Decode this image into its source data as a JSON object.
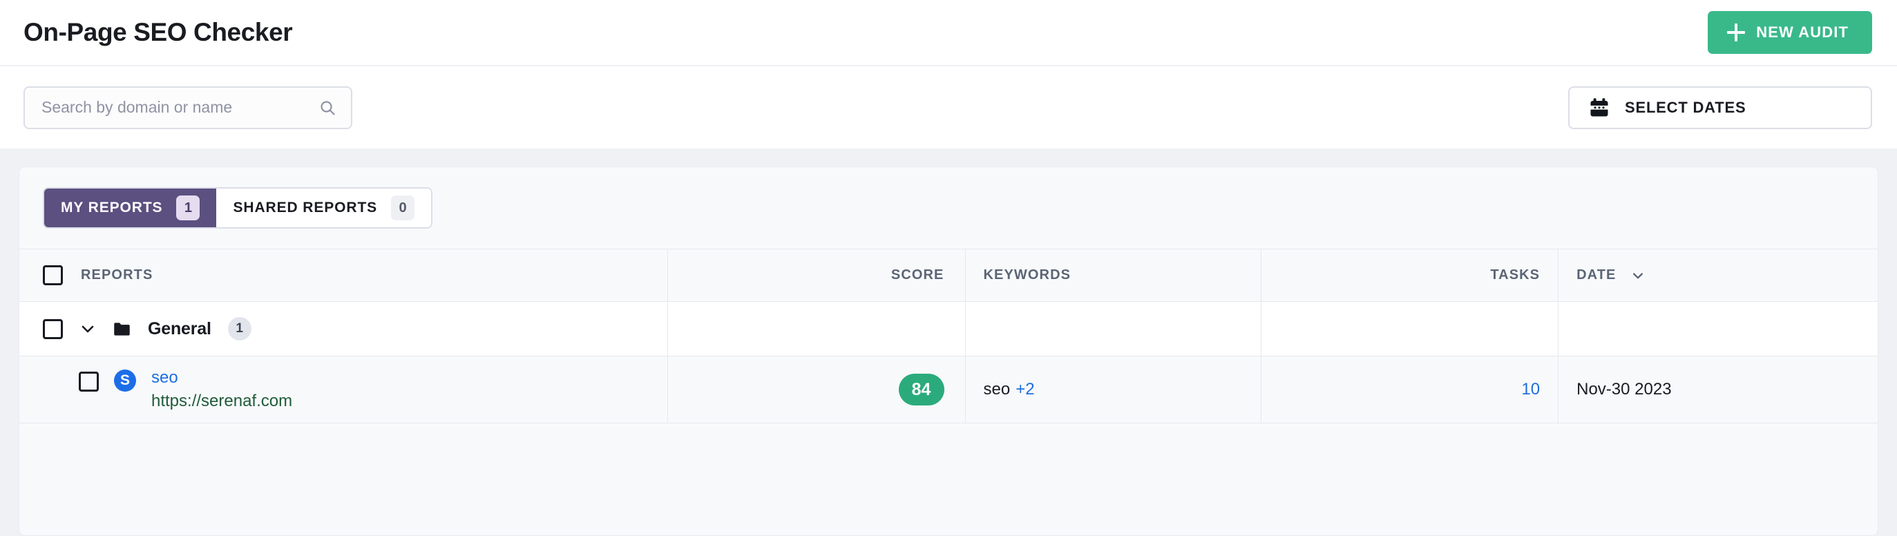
{
  "header": {
    "title": "On-Page SEO Checker",
    "new_audit_label": "NEW AUDIT",
    "plus_icon": "plus-icon"
  },
  "toolbar": {
    "search_placeholder": "Search by domain or name",
    "search_value": "",
    "search_icon": "search-icon",
    "select_dates_label": "SELECT DATES",
    "calendar_icon": "calendar-icon"
  },
  "tabs": [
    {
      "label": "MY REPORTS",
      "count": "1",
      "active": true
    },
    {
      "label": "SHARED REPORTS",
      "count": "0",
      "active": false
    }
  ],
  "table": {
    "columns": [
      {
        "key": "reports",
        "label": "REPORTS"
      },
      {
        "key": "score",
        "label": "SCORE"
      },
      {
        "key": "keywords",
        "label": "KEYWORDS"
      },
      {
        "key": "tasks",
        "label": "TASKS"
      },
      {
        "key": "date",
        "label": "DATE"
      }
    ],
    "sort": {
      "column": "DATE",
      "icon": "chevron-down-icon"
    },
    "folder": {
      "name": "General",
      "count": "1",
      "icon": "folder-icon",
      "expand_icon": "chevron-down-icon"
    },
    "rows": [
      {
        "avatar_letter": "S",
        "name": "seo",
        "url": "https://serenaf.com",
        "score": "84",
        "keywords": "seo",
        "keywords_more": "+2",
        "tasks": "10",
        "date": "Nov-30 2023"
      }
    ]
  },
  "colors": {
    "accent_green": "#39b98a",
    "score_green": "#2bab7c",
    "tab_purple": "#5b5080",
    "link_blue": "#1e6fe0",
    "url_green": "#1f5c3a",
    "page_bg": "#eff1f5"
  }
}
